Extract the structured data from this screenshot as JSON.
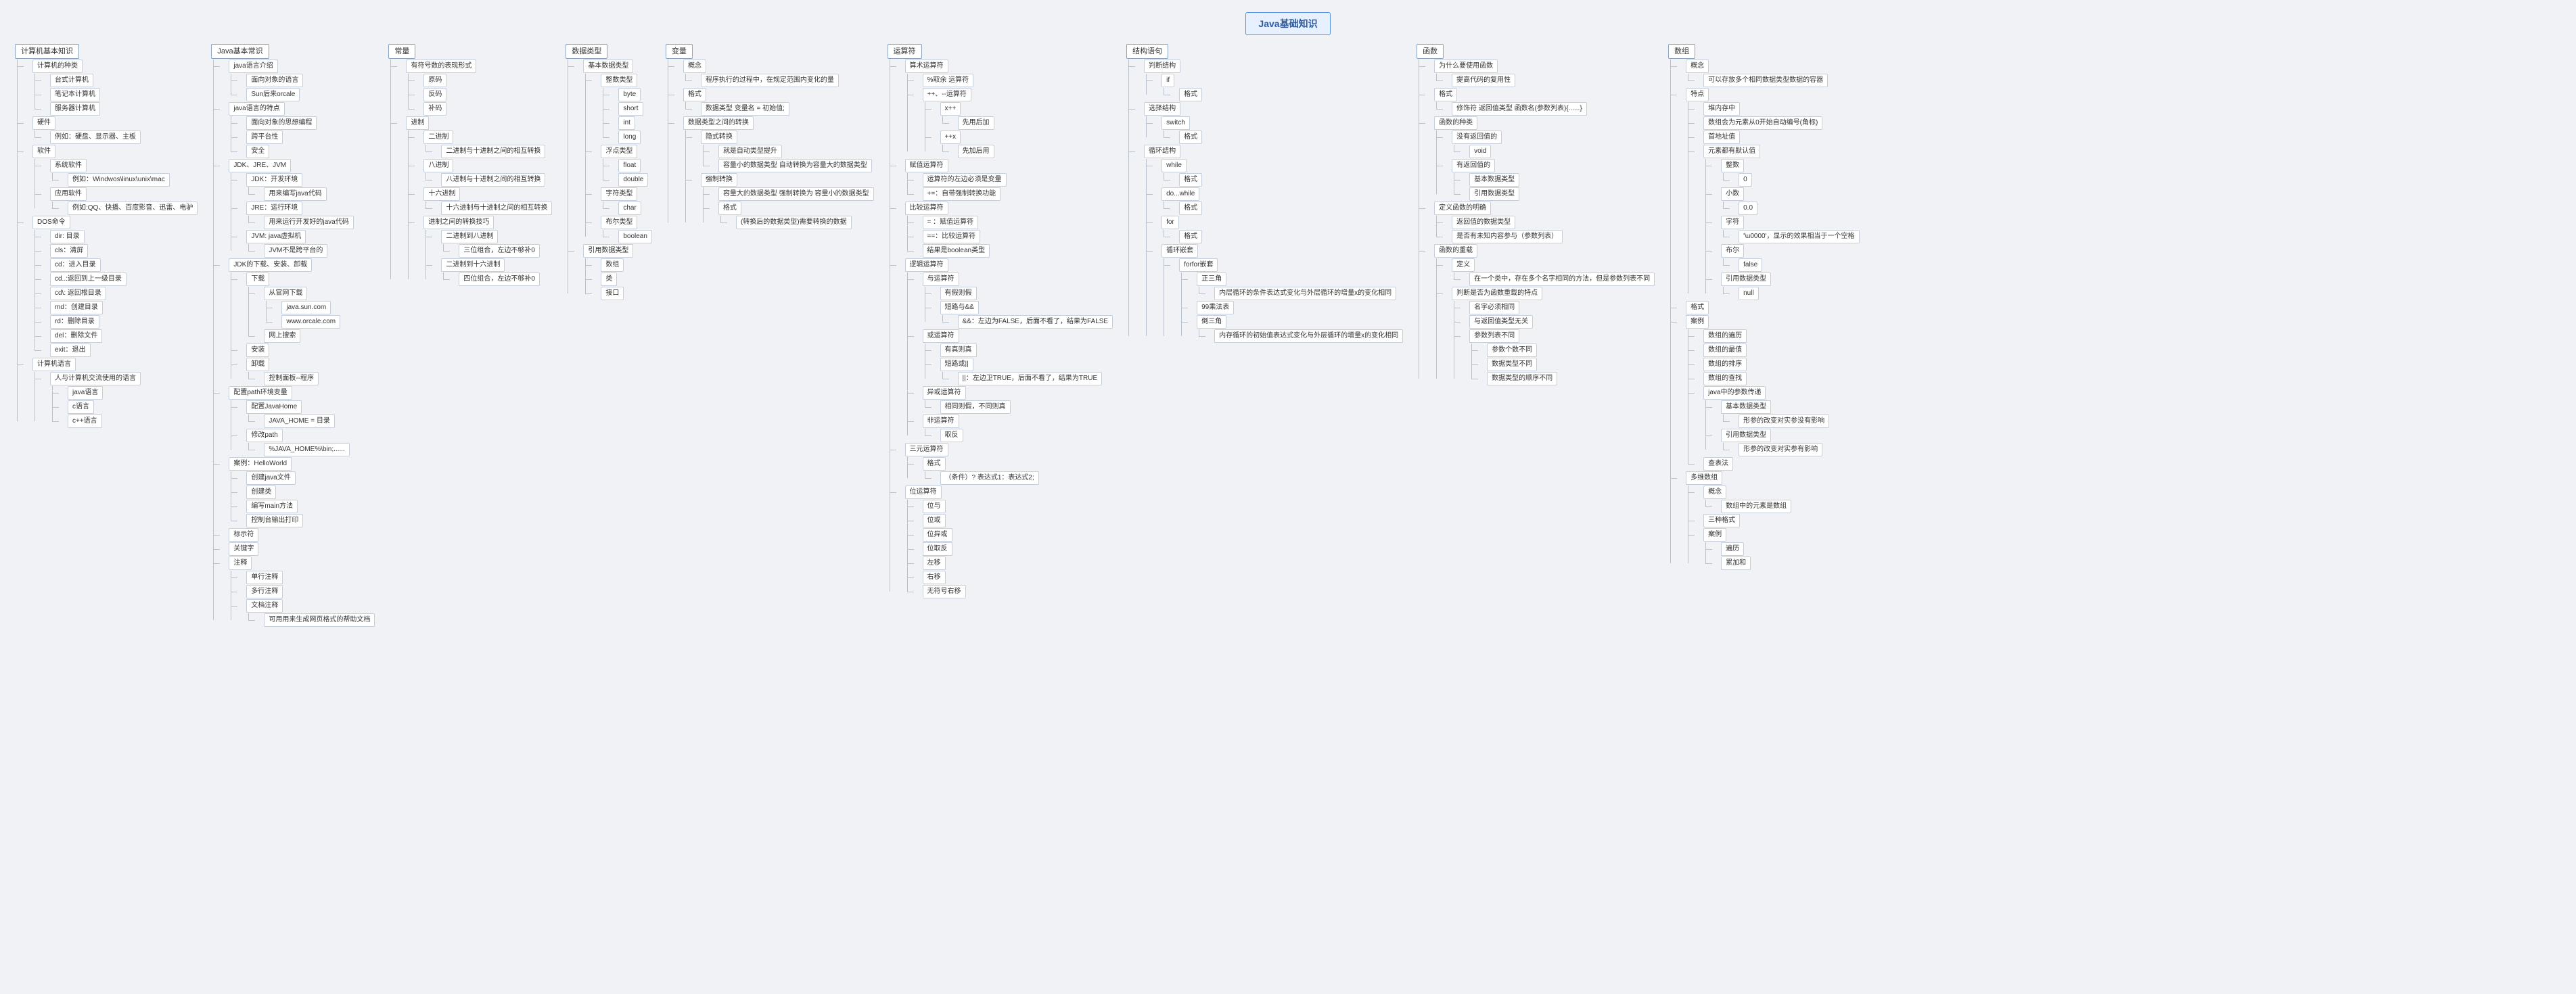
{
  "root": "Java基础知识",
  "branches": [
    {
      "label": "计算机基本知识",
      "children": [
        {
          "label": "计算机的种类",
          "children": [
            {
              "label": "台式计算机"
            },
            {
              "label": "笔记本计算机"
            },
            {
              "label": "服务器计算机"
            }
          ]
        },
        {
          "label": "硬件",
          "children": [
            {
              "label": "例如：硬盘、显示器、主板"
            }
          ]
        },
        {
          "label": "软件",
          "children": [
            {
              "label": "系统软件",
              "children": [
                {
                  "label": "例如：Windwos\\linux\\unix\\mac"
                }
              ]
            },
            {
              "label": "应用软件",
              "children": [
                {
                  "label": "例如:QQ、快播、百度影音、迅雷、电驴"
                }
              ]
            }
          ]
        },
        {
          "label": "DOS命令",
          "children": [
            {
              "label": "dir: 目录"
            },
            {
              "label": "cls：清屏"
            },
            {
              "label": "cd：进入目录"
            },
            {
              "label": "cd..:返回到上一级目录"
            },
            {
              "label": "cd\\: 返回根目录"
            },
            {
              "label": "md：创建目录"
            },
            {
              "label": "rd：删除目录"
            },
            {
              "label": "del：删除文件"
            },
            {
              "label": "exit：退出"
            }
          ]
        },
        {
          "label": "计算机语言",
          "children": [
            {
              "label": "人与计算机交流使用的语言",
              "children": [
                {
                  "label": "java语言"
                },
                {
                  "label": "c语言"
                },
                {
                  "label": "c++语言"
                }
              ]
            }
          ]
        }
      ]
    },
    {
      "label": "Java基本常识",
      "children": [
        {
          "label": "java语言介绍",
          "children": [
            {
              "label": "面向对象的语言"
            },
            {
              "label": "Sun后来orcale"
            }
          ]
        },
        {
          "label": "java语言的特点",
          "children": [
            {
              "label": "面向对象的思想编程"
            },
            {
              "label": "跨平台性"
            },
            {
              "label": "安全"
            }
          ]
        },
        {
          "label": "JDK、JRE、JVM",
          "children": [
            {
              "label": "JDK：开发环境",
              "children": [
                {
                  "label": "用来编写java代码"
                }
              ]
            },
            {
              "label": "JRE：运行环境",
              "children": [
                {
                  "label": "用来运行开发好的java代码"
                }
              ]
            },
            {
              "label": "JVM: java虚拟机",
              "children": [
                {
                  "label": "JVM不是跨平台的"
                }
              ]
            }
          ]
        },
        {
          "label": "JDK的下载、安装、卸载",
          "children": [
            {
              "label": "下载",
              "children": [
                {
                  "label": "从官网下载",
                  "children": [
                    {
                      "label": "java.sun.com"
                    },
                    {
                      "label": "www.orcale.com"
                    }
                  ]
                },
                {
                  "label": "网上搜索"
                }
              ]
            },
            {
              "label": "安装"
            },
            {
              "label": "卸载",
              "children": [
                {
                  "label": "控制面板--程序"
                }
              ]
            }
          ]
        },
        {
          "label": "配置path环境变量",
          "children": [
            {
              "label": "配置JavaHome",
              "children": [
                {
                  "label": "JAVA_HOME = 目录"
                }
              ]
            },
            {
              "label": "修改path",
              "children": [
                {
                  "label": "%JAVA_HOME%\\bin;......"
                }
              ]
            }
          ]
        },
        {
          "label": "案例：HelloWorld",
          "children": [
            {
              "label": "创建java文件"
            },
            {
              "label": "创建类"
            },
            {
              "label": "编写main方法"
            },
            {
              "label": "控制台输出打印"
            }
          ]
        },
        {
          "label": "标示符"
        },
        {
          "label": "关键字"
        },
        {
          "label": "注释",
          "children": [
            {
              "label": "单行注释"
            },
            {
              "label": "多行注释"
            },
            {
              "label": "文档注释",
              "children": [
                {
                  "label": "可用用来生成网页格式的帮助文档"
                }
              ]
            }
          ]
        }
      ]
    },
    {
      "label": "常量",
      "children": [
        {
          "label": "有符号数的表现形式",
          "children": [
            {
              "label": "原码"
            },
            {
              "label": "反码"
            },
            {
              "label": "补码"
            }
          ]
        },
        {
          "label": "进制",
          "children": [
            {
              "label": "二进制",
              "children": [
                {
                  "label": "二进制与十进制之间的相互转换"
                }
              ]
            },
            {
              "label": "八进制",
              "children": [
                {
                  "label": "八进制与十进制之间的相互转换"
                }
              ]
            },
            {
              "label": "十六进制",
              "children": [
                {
                  "label": "十六进制与十进制之间的相互转换"
                }
              ]
            },
            {
              "label": "进制之间的转换技巧",
              "children": [
                {
                  "label": "二进制到八进制",
                  "children": [
                    {
                      "label": "三位组合，左边不够补0"
                    }
                  ]
                },
                {
                  "label": "二进制到十六进制",
                  "children": [
                    {
                      "label": "四位组合，左边不够补0"
                    }
                  ]
                }
              ]
            }
          ]
        }
      ]
    },
    {
      "label": "数据类型",
      "children": [
        {
          "label": "基本数据类型",
          "children": [
            {
              "label": "整数类型",
              "children": [
                {
                  "label": "byte"
                },
                {
                  "label": "short"
                },
                {
                  "label": "int"
                },
                {
                  "label": "long"
                }
              ]
            },
            {
              "label": "浮点类型",
              "children": [
                {
                  "label": "float"
                },
                {
                  "label": "double"
                }
              ]
            },
            {
              "label": "字符类型",
              "children": [
                {
                  "label": "char"
                }
              ]
            },
            {
              "label": "布尔类型",
              "children": [
                {
                  "label": "boolean"
                }
              ]
            }
          ]
        },
        {
          "label": "引用数据类型",
          "children": [
            {
              "label": "数组"
            },
            {
              "label": "类"
            },
            {
              "label": "接口"
            }
          ]
        }
      ]
    },
    {
      "label": "变量",
      "children": [
        {
          "label": "概念",
          "children": [
            {
              "label": "程序执行的过程中，在规定范围内变化的量"
            }
          ]
        },
        {
          "label": "格式",
          "children": [
            {
              "label": "数据类型 变量名 = 初始值;"
            }
          ]
        },
        {
          "label": "数据类型之间的转换",
          "children": [
            {
              "label": "隐式转换",
              "children": [
                {
                  "label": "就是自动类型提升"
                },
                {
                  "label": "容量小的数据类型 自动转换为容量大的数据类型"
                }
              ]
            },
            {
              "label": "强制转换",
              "children": [
                {
                  "label": "容量大的数据类型 强制转换为 容量小的数据类型"
                },
                {
                  "label": "格式",
                  "children": [
                    {
                      "label": "(转换后的数据类型)需要转换的数据"
                    }
                  ]
                }
              ]
            }
          ]
        }
      ]
    },
    {
      "label": "运算符",
      "children": [
        {
          "label": "算术运算符",
          "children": [
            {
              "label": "%取余 运算符"
            },
            {
              "label": "++、--运算符",
              "children": [
                {
                  "label": "x++",
                  "children": [
                    {
                      "label": "先用后加"
                    }
                  ]
                },
                {
                  "label": "++x",
                  "children": [
                    {
                      "label": "先加后用"
                    }
                  ]
                }
              ]
            }
          ]
        },
        {
          "label": "赋值运算符",
          "children": [
            {
              "label": "运算符的左边必须是变量"
            },
            {
              "label": "+=：自带强制转换功能"
            }
          ]
        },
        {
          "label": "比较运算符",
          "children": [
            {
              "label": "= ：赋值运算符"
            },
            {
              "label": "==：比较运算符"
            },
            {
              "label": "结果是boolean类型"
            }
          ]
        },
        {
          "label": "逻辑运算符",
          "children": [
            {
              "label": "与运算符",
              "children": [
                {
                  "label": "有假则假"
                },
                {
                  "label": "短路与&&",
                  "children": [
                    {
                      "label": "&&：左边为FALSE，后面不看了，结果为FALSE"
                    }
                  ]
                }
              ]
            },
            {
              "label": "或运算符",
              "children": [
                {
                  "label": "有真则真"
                },
                {
                  "label": "短路或||",
                  "children": [
                    {
                      "label": "||：左边卫TRUE，后面不看了，结果为TRUE"
                    }
                  ]
                }
              ]
            },
            {
              "label": "异或运算符",
              "children": [
                {
                  "label": "相同则假，不同则真"
                }
              ]
            },
            {
              "label": "非运算符",
              "children": [
                {
                  "label": "取反"
                }
              ]
            }
          ]
        },
        {
          "label": "三元运算符",
          "children": [
            {
              "label": "格式",
              "children": [
                {
                  "label": "（条件）? 表达式1：表达式2;"
                }
              ]
            }
          ]
        },
        {
          "label": "位运算符",
          "children": [
            {
              "label": "位与"
            },
            {
              "label": "位或"
            },
            {
              "label": "位异或"
            },
            {
              "label": "位取反"
            },
            {
              "label": "左移"
            },
            {
              "label": "右移"
            },
            {
              "label": "无符号右移"
            }
          ]
        }
      ]
    },
    {
      "label": "结构语句",
      "children": [
        {
          "label": "判断结构",
          "children": [
            {
              "label": "if",
              "children": [
                {
                  "label": "格式"
                }
              ]
            }
          ]
        },
        {
          "label": "选择结构",
          "children": [
            {
              "label": "switch",
              "children": [
                {
                  "label": "格式"
                }
              ]
            }
          ]
        },
        {
          "label": "循环结构",
          "children": [
            {
              "label": "while",
              "children": [
                {
                  "label": "格式"
                }
              ]
            },
            {
              "label": "do...while",
              "children": [
                {
                  "label": "格式"
                }
              ]
            },
            {
              "label": "for",
              "children": [
                {
                  "label": "格式"
                }
              ]
            },
            {
              "label": "循环嵌套",
              "children": [
                {
                  "label": "forfor嵌套",
                  "children": [
                    {
                      "label": "正三角",
                      "children": [
                        {
                          "label": "内层循环的条件表达式变化与外层循环的增量x的变化相同"
                        }
                      ]
                    },
                    {
                      "label": "99乘法表"
                    },
                    {
                      "label": "倒三角",
                      "children": [
                        {
                          "label": "内存循环的初始值表达式变化与外层循环的增量x的变化相同"
                        }
                      ]
                    }
                  ]
                }
              ]
            }
          ]
        }
      ]
    },
    {
      "label": "函数",
      "children": [
        {
          "label": "为什么要使用函数",
          "children": [
            {
              "label": "提高代码的复用性"
            }
          ]
        },
        {
          "label": "格式",
          "children": [
            {
              "label": "修饰符 返回值类型 函数名(参数列表){......}"
            }
          ]
        },
        {
          "label": "函数的种类",
          "children": [
            {
              "label": "没有返回值的",
              "children": [
                {
                  "label": "void"
                }
              ]
            },
            {
              "label": "有返回值的",
              "children": [
                {
                  "label": "基本数据类型"
                },
                {
                  "label": "引用数据类型"
                }
              ]
            }
          ]
        },
        {
          "label": "定义函数的明确",
          "children": [
            {
              "label": "返回值的数据类型"
            },
            {
              "label": "是否有未知内容参与（参数列表）"
            }
          ]
        },
        {
          "label": "函数的重载",
          "children": [
            {
              "label": "定义",
              "children": [
                {
                  "label": "在一个类中，存在多个名字相同的方法，但是参数列表不同"
                }
              ]
            },
            {
              "label": "判断是否为函数重载的特点",
              "children": [
                {
                  "label": "名字必须相同"
                },
                {
                  "label": "与返回值类型无关"
                },
                {
                  "label": "参数列表不同",
                  "children": [
                    {
                      "label": "参数个数不同"
                    },
                    {
                      "label": "数据类型不同"
                    },
                    {
                      "label": "数据类型的顺序不同"
                    }
                  ]
                }
              ]
            }
          ]
        }
      ]
    },
    {
      "label": "数组",
      "children": [
        {
          "label": "概念",
          "children": [
            {
              "label": "可以存放多个相同数据类型数据的容器"
            }
          ]
        },
        {
          "label": "特点",
          "children": [
            {
              "label": "堆内存中"
            },
            {
              "label": "数组会为元素从0开始自动编号(角标)"
            },
            {
              "label": "首地址值"
            },
            {
              "label": "元素都有默认值",
              "children": [
                {
                  "label": "整数",
                  "children": [
                    {
                      "label": "0"
                    }
                  ]
                },
                {
                  "label": "小数",
                  "children": [
                    {
                      "label": "0.0"
                    }
                  ]
                },
                {
                  "label": "字符",
                  "children": [
                    {
                      "label": "'\\u0000'，显示的效果相当于一个空格"
                    }
                  ]
                },
                {
                  "label": "布尔",
                  "children": [
                    {
                      "label": "false"
                    }
                  ]
                },
                {
                  "label": "引用数据类型",
                  "children": [
                    {
                      "label": "null"
                    }
                  ]
                }
              ]
            }
          ]
        },
        {
          "label": "格式"
        },
        {
          "label": "案例",
          "children": [
            {
              "label": "数组的遍历"
            },
            {
              "label": "数组的最值"
            },
            {
              "label": "数组的排序"
            },
            {
              "label": "数组的查找"
            },
            {
              "label": "java中的参数传递",
              "children": [
                {
                  "label": "基本数据类型",
                  "children": [
                    {
                      "label": "形参的改变对实参没有影响"
                    }
                  ]
                },
                {
                  "label": "引用数据类型",
                  "children": [
                    {
                      "label": "形参的改变对实参有影响"
                    }
                  ]
                }
              ]
            },
            {
              "label": "查表法"
            }
          ]
        },
        {
          "label": "多维数组",
          "children": [
            {
              "label": "概念",
              "children": [
                {
                  "label": "数组中的元素是数组"
                }
              ]
            },
            {
              "label": "三种格式"
            },
            {
              "label": "案例",
              "children": [
                {
                  "label": "遍历"
                },
                {
                  "label": "累加和"
                }
              ]
            }
          ]
        }
      ]
    }
  ]
}
